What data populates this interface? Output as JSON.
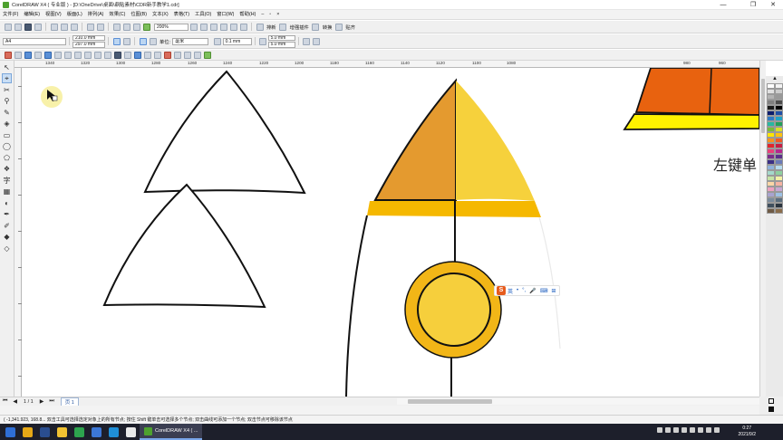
{
  "window": {
    "title": "CorelDRAW X4 ( 专业版 ) - [D:\\OneDrive\\桌面\\鼎貼素材\\CDR新手教学1.cdr]",
    "controls": {
      "minimize": "—",
      "maximize": "❐",
      "close": "✕"
    }
  },
  "menu": {
    "items": [
      "文件(F)",
      "编辑(E)",
      "视图(V)",
      "版面(L)",
      "排列(A)",
      "效果(C)",
      "位图(B)",
      "文本(X)",
      "表格(T)",
      "工具(O)",
      "窗口(W)",
      "帮助(H)"
    ],
    "doc_controls": [
      "–",
      "▫",
      "×"
    ]
  },
  "toolbar1": {
    "zoom": "200%",
    "buttons": [
      "排新",
      "增强插件",
      "转换",
      "贴齐"
    ]
  },
  "propbar": {
    "paper": "A4",
    "width": "210.0 mm",
    "height": "297.0 mm",
    "units_label": "单位:",
    "units": "毫米",
    "nudge": "0.1 mm",
    "dup_x": "5.0 mm",
    "dup_y": "5.0 mm"
  },
  "ruler": {
    "labels": [
      "1340",
      "1320",
      "1300",
      "1280",
      "1260",
      "1240",
      "1220",
      "1200",
      "1180",
      "1160",
      "1140",
      "1120",
      "1100",
      "1080",
      "980",
      "960"
    ]
  },
  "canvas": {
    "overlay_text": "左键单",
    "ime_bar": {
      "logo": "S",
      "lang": "英",
      "items": [
        "•",
        "°,",
        "🎤",
        "⌨",
        "⊞"
      ]
    }
  },
  "pagebar": {
    "first": "⏮",
    "prev": "◀",
    "page_count": "1 / 1",
    "next": "▶",
    "last": "⏭",
    "tab": "页 1"
  },
  "status": {
    "text": "( -1,341.923, 168.8... 双击工具可选择选定对象上的所有节点; 按住 Shift 键单击可选择多个节点; 双击曲线可添加一个节点; 双击节点可移除该节点"
  },
  "taskbar": {
    "app_label": "CorelDRAW X4 ( ...",
    "time": "0:27",
    "date": "2021/9/2"
  },
  "palette": {
    "colors": [
      "#ffffff",
      "#f2f2f2",
      "#e0e0e0",
      "#cccccc",
      "#b3b3b3",
      "#999999",
      "#808080",
      "#4d4d4d",
      "#1a1a1a",
      "#000000",
      "#0c1d6e",
      "#1e4fa8",
      "#2f7ac4",
      "#1fa3c7",
      "#28b8a2",
      "#22a05a",
      "#79bb3a",
      "#d8e02a",
      "#ffe400",
      "#ffc20e",
      "#f7931e",
      "#f15a24",
      "#e3262b",
      "#c81e43",
      "#e8407a",
      "#b5278f",
      "#7d2a8a",
      "#5b2f8b",
      "#3b2f85",
      "#6b7ab8",
      "#8fb2dc",
      "#b7dcef",
      "#a4d8cc",
      "#8ecf9f",
      "#c5e3a5",
      "#f3f1a6",
      "#fbd6a6",
      "#f5b3a3",
      "#eca1c0",
      "#c8a8d3",
      "#a8a3cf",
      "#9ec1e4",
      "#7a8b9c",
      "#5c6e7f",
      "#3f4f5e",
      "#2b3540",
      "#6e5a45",
      "#8a6d4b"
    ]
  }
}
